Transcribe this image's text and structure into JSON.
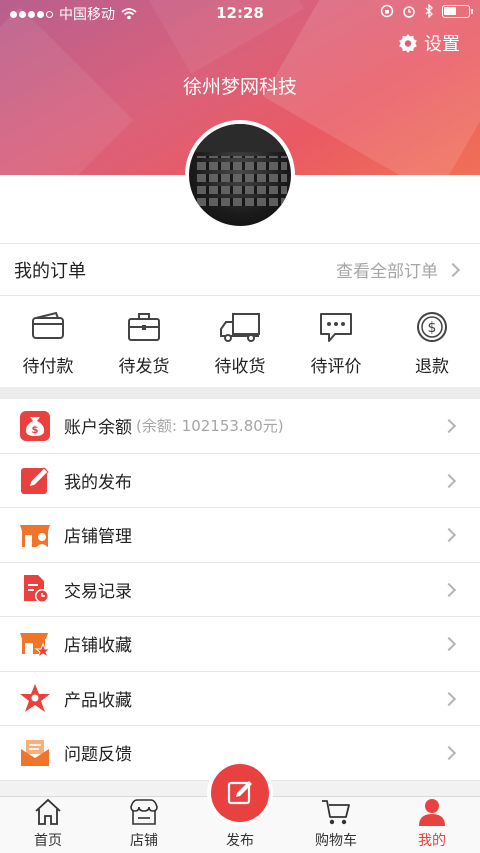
{
  "status_bar": {
    "carrier": "中国移动",
    "time": "12:28"
  },
  "header": {
    "settings_label": "设置",
    "shop_name": "徐州梦网科技"
  },
  "orders": {
    "title": "我的订单",
    "view_all": "查看全部订单",
    "items": [
      {
        "label": "待付款",
        "icon": "wallet-icon"
      },
      {
        "label": "待发货",
        "icon": "briefcase-icon"
      },
      {
        "label": "待收货",
        "icon": "truck-icon"
      },
      {
        "label": "待评价",
        "icon": "comment-icon"
      },
      {
        "label": "退款",
        "icon": "dollar-coin-icon"
      }
    ]
  },
  "menu": {
    "items": [
      {
        "label": "账户余额",
        "note": "(余额: 102153.80元)",
        "icon": "money-bag-icon"
      },
      {
        "label": "我的发布",
        "icon": "edit-icon"
      },
      {
        "label": "店铺管理",
        "icon": "store-manager-icon"
      },
      {
        "label": "交易记录",
        "icon": "record-clock-icon"
      },
      {
        "label": "店铺收藏",
        "icon": "store-star-icon"
      },
      {
        "label": "产品收藏",
        "icon": "star-icon"
      },
      {
        "label": "问题反馈",
        "icon": "mail-feedback-icon"
      }
    ]
  },
  "tabbar": {
    "items": [
      {
        "label": "首页",
        "icon": "home-icon"
      },
      {
        "label": "店铺",
        "icon": "shop-icon"
      },
      {
        "label": "发布",
        "icon": "publish-icon"
      },
      {
        "label": "购物车",
        "icon": "cart-icon"
      },
      {
        "label": "我的",
        "icon": "user-icon",
        "active": true
      }
    ]
  },
  "colors": {
    "accent": "#e8413f",
    "header_start": "#b85f8e",
    "header_end": "#f07057",
    "muted": "#a6a6a6"
  }
}
